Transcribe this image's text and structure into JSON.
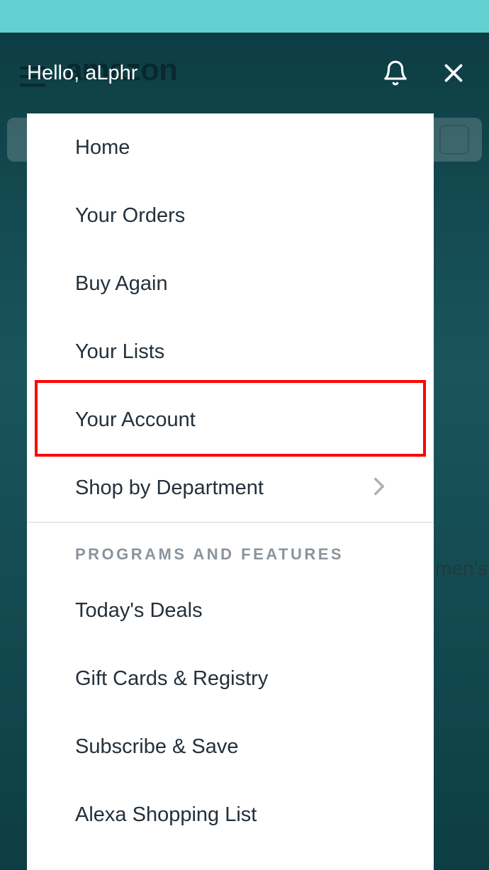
{
  "header": {
    "greeting": "Hello, aLphr"
  },
  "menu": {
    "items": [
      {
        "label": "Home",
        "hasChevron": false
      },
      {
        "label": "Your Orders",
        "hasChevron": false
      },
      {
        "label": "Buy Again",
        "hasChevron": false
      },
      {
        "label": "Your Lists",
        "hasChevron": false
      },
      {
        "label": "Your Account",
        "hasChevron": false,
        "highlighted": true
      },
      {
        "label": "Shop by Department",
        "hasChevron": true
      }
    ],
    "section_header": "PROGRAMS AND FEATURES",
    "programs": [
      {
        "label": "Today's Deals"
      },
      {
        "label": "Gift Cards & Registry"
      },
      {
        "label": "Subscribe & Save"
      },
      {
        "label": "Alexa Shopping List"
      }
    ]
  },
  "backdrop": {
    "logo": "amazon",
    "tab_label": "men's"
  }
}
